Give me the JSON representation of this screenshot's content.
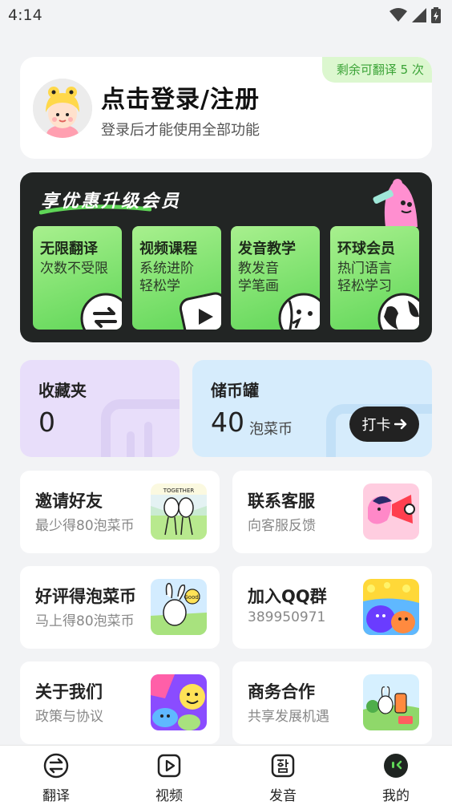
{
  "status_bar": {
    "time": "4:14"
  },
  "login": {
    "quota_badge": "剩余可翻译 5 次",
    "title": "点击登录/注册",
    "subtitle": "登录后才能使用全部功能"
  },
  "vip": {
    "title": "享优惠升级会员",
    "tiles": [
      {
        "title": "无限翻译",
        "desc": [
          "次数不受限"
        ],
        "icon": "swap-arrows-icon"
      },
      {
        "title": "视频课程",
        "desc": [
          "系统进阶",
          "轻松学"
        ],
        "icon": "play-icon"
      },
      {
        "title": "发音教学",
        "desc": [
          "教发音",
          "学笔画"
        ],
        "icon": "face-icon"
      },
      {
        "title": "环球会员",
        "desc": [
          "热门语言",
          "轻松学习"
        ],
        "icon": "globe-icon"
      }
    ]
  },
  "favorites": {
    "label": "收藏夹",
    "count": "0"
  },
  "coins": {
    "label": "储币罐",
    "amount": "40",
    "unit": "泡菜币",
    "checkin_label": "打卡"
  },
  "menu": [
    {
      "title": "邀请好友",
      "subtitle": "最少得80泡菜币"
    },
    {
      "title": "联系客服",
      "subtitle": "向客服反馈"
    },
    {
      "title": "好评得泡菜币",
      "subtitle": "马上得80泡菜币"
    },
    {
      "title": "加入QQ群",
      "subtitle": "389950971"
    },
    {
      "title": "关于我们",
      "subtitle": "政策与协议"
    },
    {
      "title": "商务合作",
      "subtitle": "共享发展机遇"
    }
  ],
  "art_text": {
    "together": "TOGETHER",
    "good": "Good!"
  },
  "nav": [
    {
      "label": "翻译",
      "icon": "translate-icon"
    },
    {
      "label": "视频",
      "icon": "video-icon"
    },
    {
      "label": "发音",
      "icon": "pronunciation-icon"
    },
    {
      "label": "我的",
      "icon": "profile-icon"
    }
  ],
  "colors": {
    "accent_green": "#5fd657",
    "badge_green": "#3aa336",
    "dark": "#222524"
  }
}
